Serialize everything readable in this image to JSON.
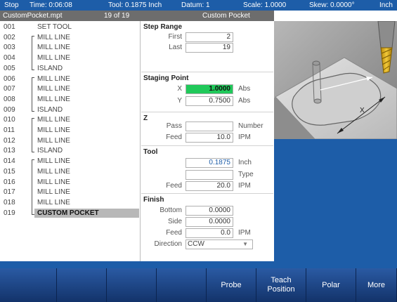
{
  "status_bar": {
    "mode": "Stop",
    "time": "Time: 0:06:08",
    "tool": "Tool: 0.1875 Inch",
    "datum": "Datum: 1",
    "scale": "Scale: 1.0000",
    "skew": "Skew: 0.0000°",
    "units": "Inch"
  },
  "title_bar": {
    "file": "CustomPocket.mpt",
    "position": "19 of 19",
    "step_name": "Custom Pocket"
  },
  "program": {
    "steps": [
      {
        "num": "001",
        "label": "SET TOOL",
        "bracket": "none"
      },
      {
        "num": "002",
        "label": "MILL LINE",
        "bracket": "top"
      },
      {
        "num": "003",
        "label": "MILL LINE",
        "bracket": "mid"
      },
      {
        "num": "004",
        "label": "MILL LINE",
        "bracket": "mid"
      },
      {
        "num": "005",
        "label": "ISLAND",
        "bracket": "bottom"
      },
      {
        "num": "006",
        "label": "MILL LINE",
        "bracket": "top"
      },
      {
        "num": "007",
        "label": "MILL LINE",
        "bracket": "mid"
      },
      {
        "num": "008",
        "label": "MILL LINE",
        "bracket": "mid"
      },
      {
        "num": "009",
        "label": "ISLAND",
        "bracket": "bottom"
      },
      {
        "num": "010",
        "label": "MILL LINE",
        "bracket": "top"
      },
      {
        "num": "011",
        "label": "MILL LINE",
        "bracket": "mid"
      },
      {
        "num": "012",
        "label": "MILL LINE",
        "bracket": "mid"
      },
      {
        "num": "013",
        "label": "ISLAND",
        "bracket": "bottom"
      },
      {
        "num": "014",
        "label": "MILL LINE",
        "bracket": "top"
      },
      {
        "num": "015",
        "label": "MILL LINE",
        "bracket": "mid"
      },
      {
        "num": "016",
        "label": "MILL LINE",
        "bracket": "mid"
      },
      {
        "num": "017",
        "label": "MILL LINE",
        "bracket": "mid"
      },
      {
        "num": "018",
        "label": "MILL LINE",
        "bracket": "mid"
      },
      {
        "num": "019",
        "label": "CUSTOM POCKET",
        "bracket": "bottom",
        "selected": true
      }
    ]
  },
  "form": {
    "step_range": {
      "title": "Step Range",
      "first_label": "First",
      "first_value": "2",
      "last_label": "Last",
      "last_value": "19"
    },
    "staging_point": {
      "title": "Staging Point",
      "x_label": "X",
      "x_value": "1.0000",
      "x_unit": "Abs",
      "y_label": "Y",
      "y_value": "0.7500",
      "y_unit": "Abs"
    },
    "z": {
      "title": "Z",
      "pass_label": "Pass",
      "pass_value": "",
      "pass_unit": "Number",
      "feed_label": "Feed",
      "feed_value": "10.0",
      "feed_unit": "IPM"
    },
    "tool": {
      "title": "Tool",
      "diameter_value": "0.1875",
      "diameter_unit": "Inch",
      "type_value": "",
      "type_unit": "Type",
      "feed_label": "Feed",
      "feed_value": "20.0",
      "feed_unit": "IPM"
    },
    "finish": {
      "title": "Finish",
      "bottom_label": "Bottom",
      "bottom_value": "0.0000",
      "side_label": "Side",
      "side_value": "0.0000",
      "feed_label": "Feed",
      "feed_value": "0.0",
      "feed_unit": "IPM",
      "direction_label": "Direction",
      "direction_value": "CCW"
    }
  },
  "preview": {
    "dimension_label": "X"
  },
  "softkeys": [
    "",
    "",
    "",
    "",
    "Probe",
    "Teach Position",
    "Polar",
    "More"
  ],
  "colors": {
    "status_blue": "#1d5da8",
    "softkey_blue": "#1a3f7a",
    "active_field": "#20c95a",
    "selected_row": "#b8b8b8",
    "tool_gold": "#d9a91a"
  }
}
